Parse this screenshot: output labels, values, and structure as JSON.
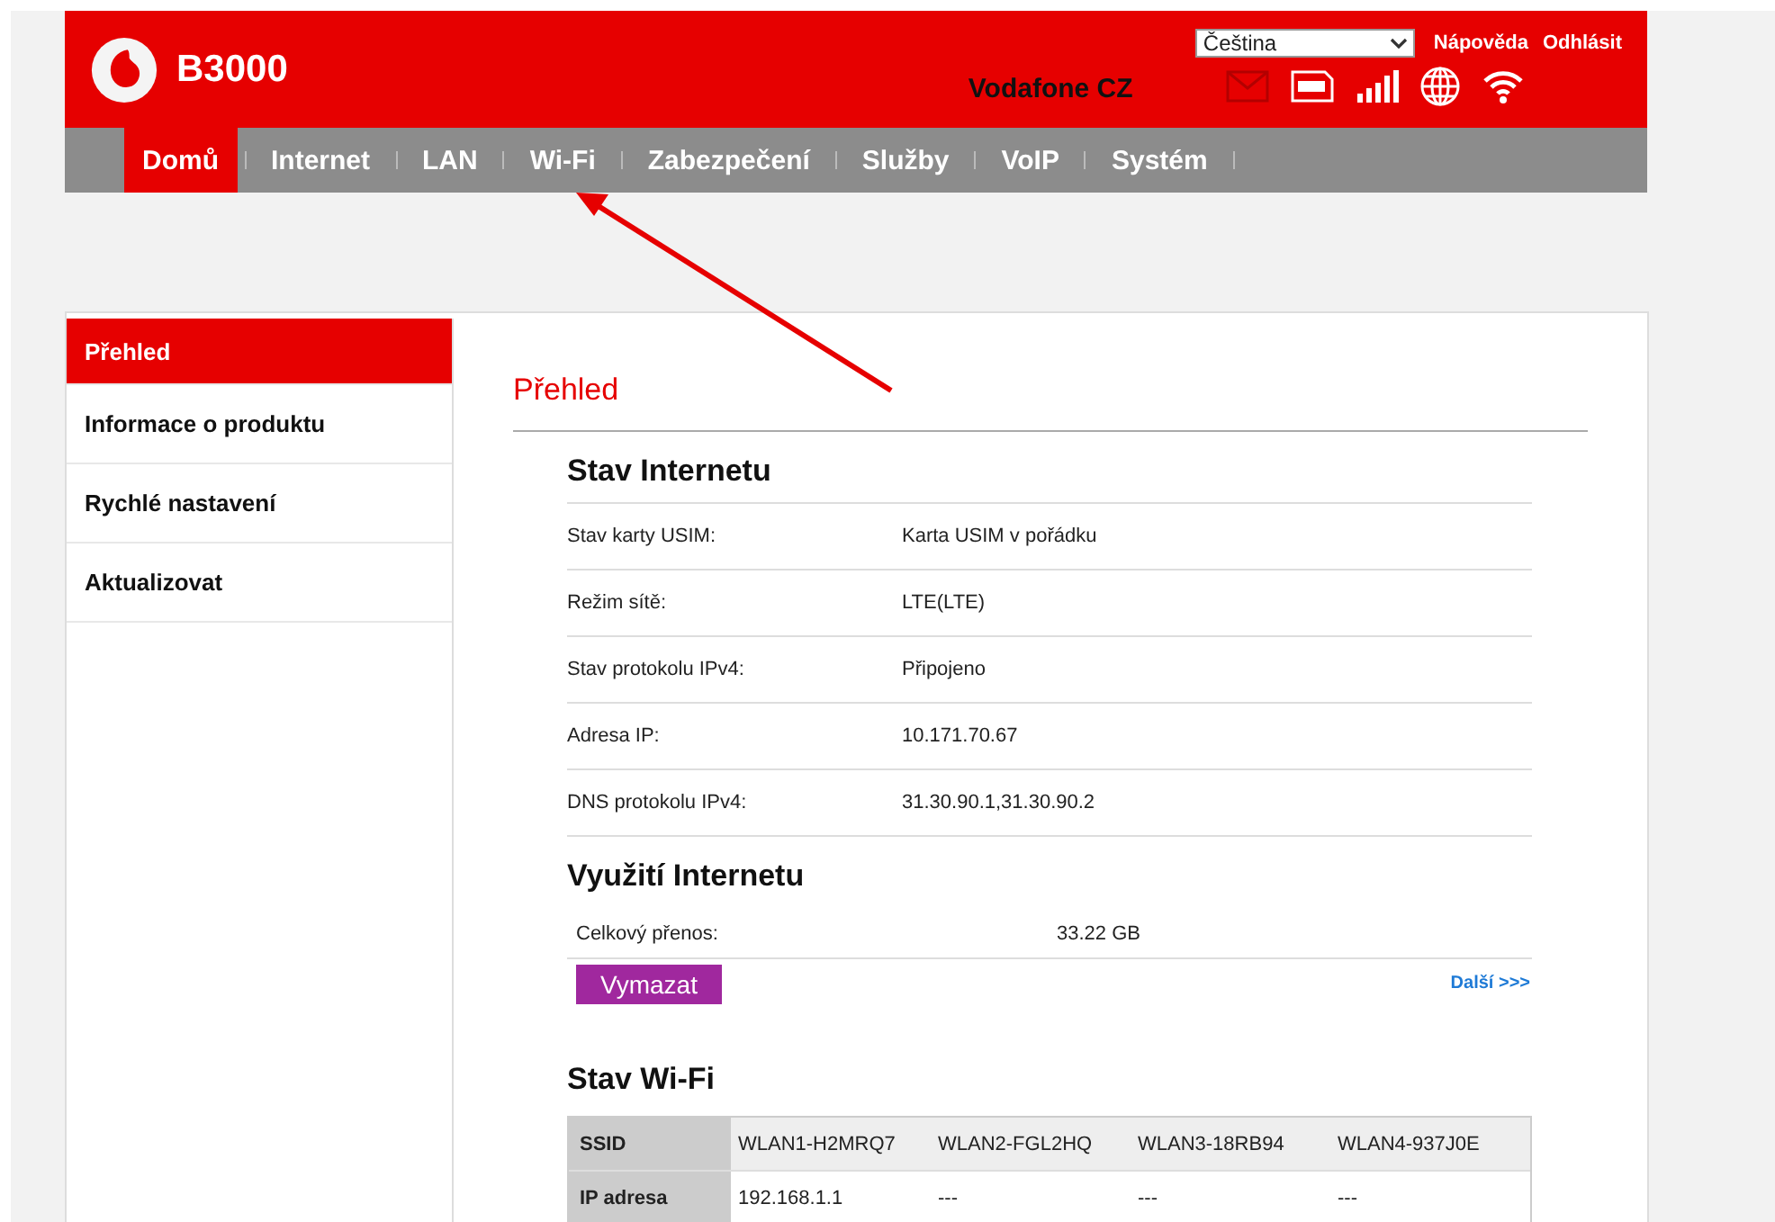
{
  "header": {
    "product": "B3000",
    "operator": "Vodafone CZ",
    "language": "Čeština",
    "links": [
      "Nápověda",
      "Odhlásit"
    ],
    "status_icons": [
      {
        "kind": "mail",
        "on": false
      },
      {
        "kind": "usim",
        "on": true
      },
      {
        "kind": "signal",
        "on": true
      },
      {
        "kind": "globe",
        "on": true
      },
      {
        "kind": "wifi",
        "on": true
      }
    ]
  },
  "nav": [
    {
      "label": "Domů",
      "selected": true
    },
    {
      "label": "Internet",
      "selected": false
    },
    {
      "label": "LAN",
      "selected": false
    },
    {
      "label": "Wi-Fi",
      "selected": false
    },
    {
      "label": "Zabezpečení",
      "selected": false
    },
    {
      "label": "Služby",
      "selected": false
    },
    {
      "label": "VoIP",
      "selected": false
    },
    {
      "label": "Systém",
      "selected": false
    }
  ],
  "sidebar": {
    "items": [
      {
        "label": "Přehled",
        "selected": true
      },
      {
        "label": "Informace o produktu",
        "selected": false
      },
      {
        "label": "Rychlé nastavení",
        "selected": false
      },
      {
        "label": "Aktualizovat",
        "selected": false
      }
    ]
  },
  "page_title": "Přehled",
  "internet_status": {
    "title": "Stav Internetu",
    "rows": [
      {
        "label": "Stav karty USIM:",
        "value": "Karta USIM v pořádku"
      },
      {
        "label": "Režim sítě:",
        "value": "LTE(LTE)"
      },
      {
        "label": "Stav protokolu IPv4:",
        "value": "Připojeno"
      },
      {
        "label": "Adresa IP:",
        "value": "10.171.70.67"
      },
      {
        "label": "DNS protokolu IPv4:",
        "value": "31.30.90.1,31.30.90.2"
      }
    ]
  },
  "internet_usage": {
    "title": "Využití Internetu",
    "label": "Celkový přenos:",
    "value": "33.22 GB",
    "clear_button": "Vymazat",
    "more_link": "Další >>>"
  },
  "wifi_status": {
    "title": "Stav Wi-Fi",
    "rows": [
      {
        "label": "SSID",
        "cells": [
          "WLAN1-H2MRQ7",
          "WLAN2-FGL2HQ",
          "WLAN3-18RB94",
          "WLAN4-937J0E"
        ]
      },
      {
        "label": "IP adresa",
        "cells": [
          "192.168.1.1",
          "---",
          "---",
          "---"
        ]
      }
    ]
  }
}
